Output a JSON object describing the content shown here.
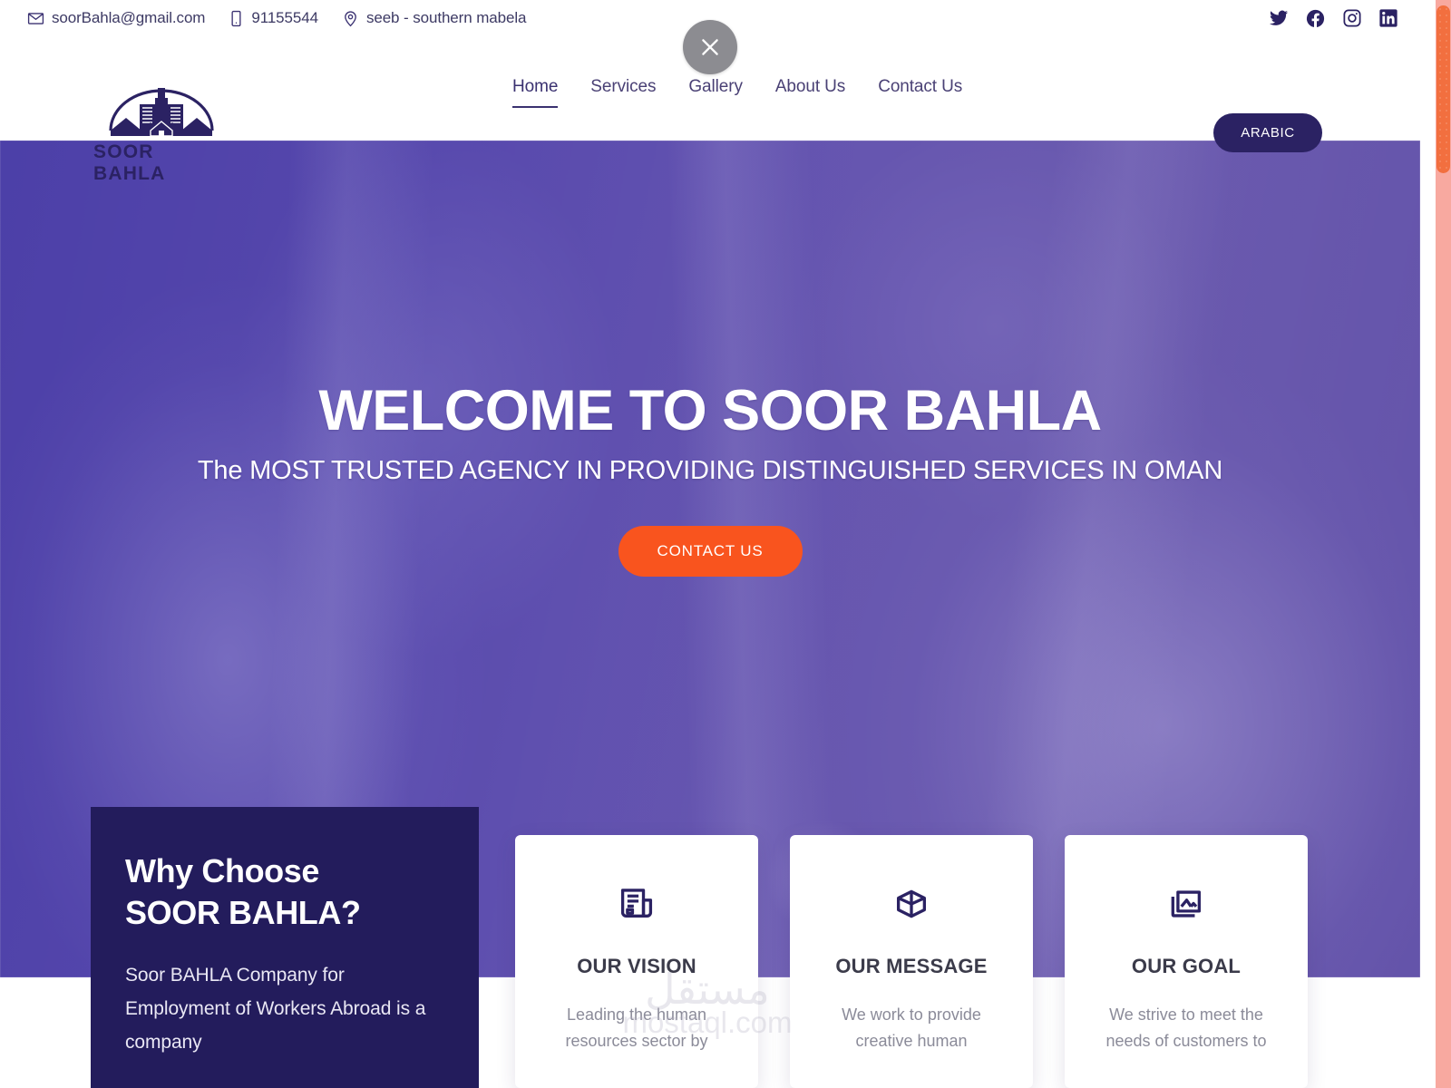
{
  "topbar": {
    "email": "soorBahla@gmail.com",
    "phone": "91155544",
    "location": "seeb - southern mabela",
    "socials": [
      {
        "name": "twitter-icon",
        "label": "Twitter"
      },
      {
        "name": "facebook-icon",
        "label": "Facebook"
      },
      {
        "name": "instagram-icon",
        "label": "Instagram"
      },
      {
        "name": "linkedin-icon",
        "label": "LinkedIn"
      }
    ]
  },
  "overlay": {
    "close_label": "×"
  },
  "header": {
    "logo_text": "SOOR BAHLA",
    "nav": [
      {
        "label": "Home",
        "active": true
      },
      {
        "label": "Services",
        "active": false
      },
      {
        "label": "Gallery",
        "active": false
      },
      {
        "label": "About Us",
        "active": false
      },
      {
        "label": "Contact Us",
        "active": false
      }
    ],
    "language_button": "ARABIC"
  },
  "hero": {
    "title": "WELCOME TO SOOR BAHLA",
    "subtitle": "The MOST TRUSTED AGENCY IN PROVIDING DISTINGUISHED SERVICES IN OMAN",
    "cta": "CONTACT US"
  },
  "why_choose": {
    "title_line1": "Why Choose",
    "title_line2": "SOOR BAHLA?",
    "body": "Soor BAHLA Company for Employment of Workers Abroad is a company"
  },
  "cards": [
    {
      "icon": "newspaper-icon",
      "title": "OUR VISION",
      "text": "Leading the human resources sector by"
    },
    {
      "icon": "cube-icon",
      "title": "OUR MESSAGE",
      "text": "We work to provide creative human"
    },
    {
      "icon": "image-gallery-icon",
      "title": "OUR GOAL",
      "text": "We strive to meet the needs of customers to"
    }
  ],
  "watermark": {
    "arabic": "مستقل",
    "latin": "mostaql.com"
  },
  "colors": {
    "brand_navy": "#2b2263",
    "panel_navy": "#231c5c",
    "hero_purple": "#5a4cae",
    "accent_orange": "#f9541e",
    "scrollbar_thumb": "#f26f3f",
    "scrollbar_track": "#f8a9a0"
  }
}
